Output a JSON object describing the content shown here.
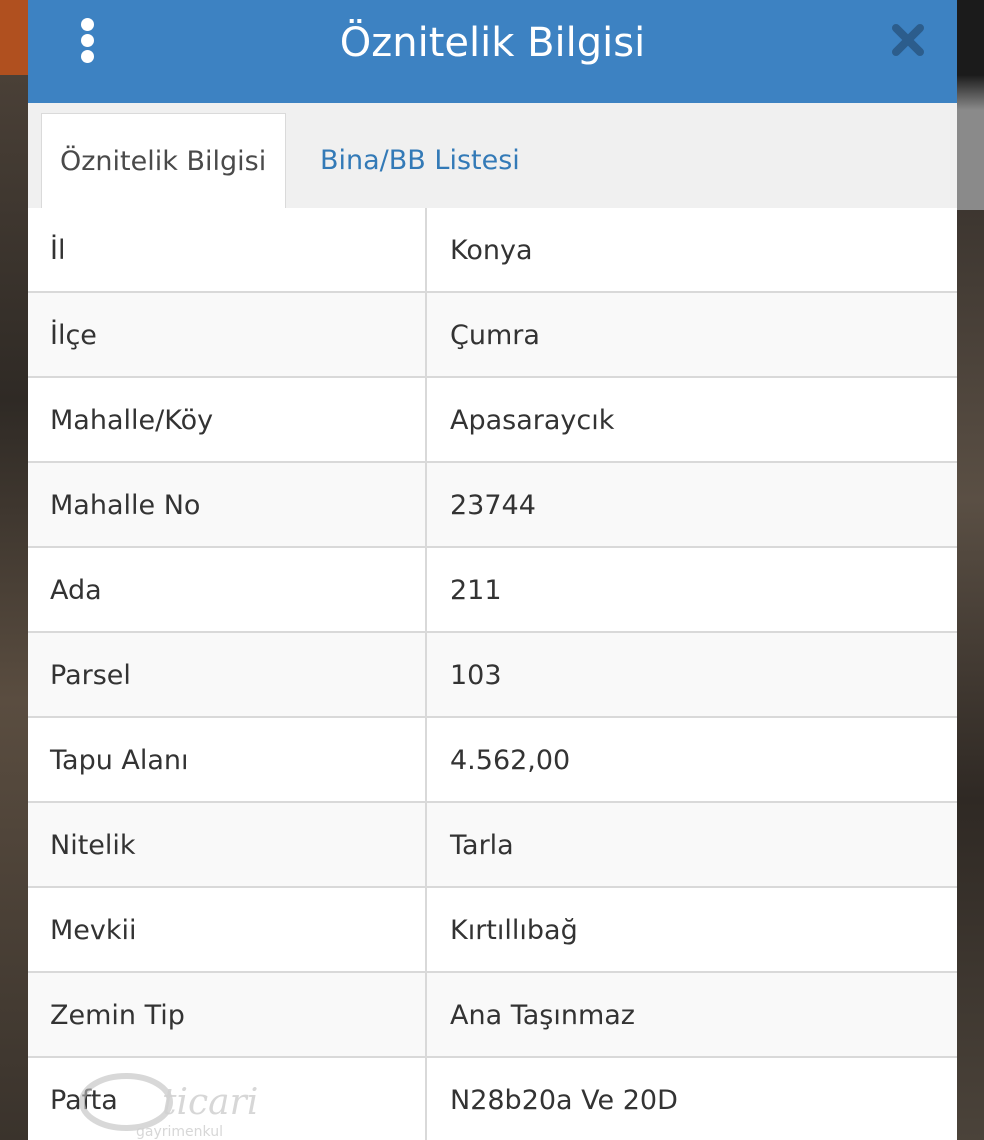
{
  "dialog": {
    "title": "Öznitelik Bilgisi",
    "menu_icon": "kebab-menu-icon",
    "close_icon": "close-icon",
    "accent_color": "#3d82c2"
  },
  "tabs": [
    {
      "label": "Öznitelik Bilgisi",
      "active": true
    },
    {
      "label": "Bina/BB Listesi",
      "active": false
    }
  ],
  "attributes": [
    {
      "key": "İl",
      "value": "Konya"
    },
    {
      "key": "İlçe",
      "value": "Çumra"
    },
    {
      "key": "Mahalle/Köy",
      "value": "Apasaraycık"
    },
    {
      "key": "Mahalle No",
      "value": "23744"
    },
    {
      "key": "Ada",
      "value": "211"
    },
    {
      "key": "Parsel",
      "value": "103"
    },
    {
      "key": "Tapu Alanı",
      "value": "4.562,00"
    },
    {
      "key": "Nitelik",
      "value": "Tarla"
    },
    {
      "key": "Mevkii",
      "value": "Kırtıllıbağ"
    },
    {
      "key": "Zemin Tip",
      "value": "Ana Taşınmaz"
    },
    {
      "key": "Pafta",
      "value": "N28b20a Ve 20D"
    }
  ],
  "watermark": {
    "brand": "ticari",
    "sub": "gayrimenkul"
  }
}
